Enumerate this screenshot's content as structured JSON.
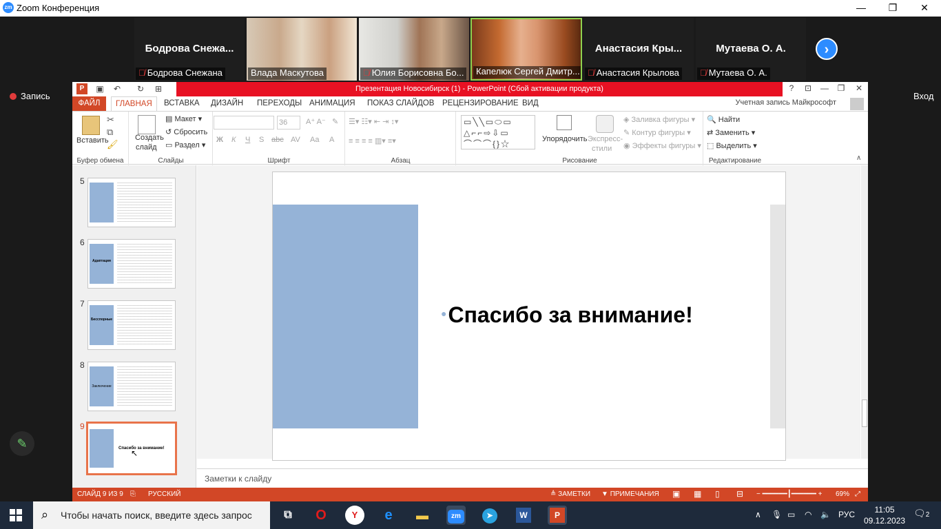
{
  "zoom": {
    "title": "Zoom Конференция",
    "logo": "zm",
    "record_label": "Запись",
    "login_label": "Вход",
    "participants": [
      {
        "big_name": "Бодрова  Снежа...",
        "caption": "Бодрова Снежана",
        "muted": true,
        "video": false
      },
      {
        "big_name": "",
        "caption": "Влада Маскутова",
        "muted": false,
        "video": true
      },
      {
        "big_name": "",
        "caption": "Юлия Борисовна Бо...",
        "muted": true,
        "video": true
      },
      {
        "big_name": "",
        "caption": "Капелюк Сергей Дмитр...",
        "muted": false,
        "video": true,
        "active": true
      },
      {
        "big_name": "Анастасия  Кры...",
        "caption": "Анастасия Крылова",
        "muted": true,
        "video": false
      },
      {
        "big_name": "Мутаева О. А.",
        "caption": "Мутаева О. А.",
        "muted": true,
        "video": false
      }
    ]
  },
  "ppt": {
    "title": "Презентация Новосибирск (1) -  PowerPoint (Сбой активации продукта)",
    "tabs": [
      "ФАЙЛ",
      "ГЛАВНАЯ",
      "ВСТАВКА",
      "ДИЗАЙН",
      "ПЕРЕХОДЫ",
      "АНИМАЦИЯ",
      "ПОКАЗ СЛАЙДОВ",
      "РЕЦЕНЗИРОВАНИЕ",
      "ВИД"
    ],
    "account": "Учетная запись Майкрософт",
    "ribbon": {
      "paste": "Вставить",
      "clipboard": "Буфер обмена",
      "new_slide_1": "Создать",
      "new_slide_2": "слайд",
      "layout": "Макет",
      "reset": "Сбросить",
      "section": "Раздел",
      "slides": "Слайды",
      "font_size": "36",
      "font_group": "Шрифт",
      "font_b": "Ж",
      "font_i": "К",
      "font_u": "Ч",
      "font_s": "S",
      "font_abc": "abc",
      "font_av": "AV",
      "font_aa": "Aa",
      "font_a": "A",
      "paragraph": "Абзац",
      "arrange": "Упорядочить",
      "quick_styles_1": "Экспресс-",
      "quick_styles_2": "стили",
      "shape_fill": "Заливка фигуры",
      "shape_outline": "Контур фигуры",
      "shape_effects": "Эффекты фигуры",
      "drawing": "Рисование",
      "find": "Найти",
      "replace": "Заменить",
      "select": "Выделить",
      "editing": "Редактирование"
    },
    "thumbnails": [
      {
        "num": "5",
        "text": ""
      },
      {
        "num": "6",
        "text": "Адаптация"
      },
      {
        "num": "7",
        "text": "Бесспорные"
      },
      {
        "num": "8",
        "text": "Заключение"
      },
      {
        "num": "9",
        "text": "Спасибо за внимание!",
        "selected": true
      }
    ],
    "slide_text": "Спасибо за внимание!",
    "notes_placeholder": "Заметки к слайду",
    "status": {
      "slide": "СЛАЙД 9 ИЗ 9",
      "lang": "РУССКИЙ",
      "notes": "ЗАМЕТКИ",
      "comments": "ПРИМЕЧАНИЯ",
      "zoom": "69%"
    }
  },
  "taskbar": {
    "search_placeholder": "Чтобы начать поиск, введите здесь запрос",
    "lang": "РУС",
    "time": "11:05",
    "date": "09.12.2023",
    "notifications": "2"
  }
}
